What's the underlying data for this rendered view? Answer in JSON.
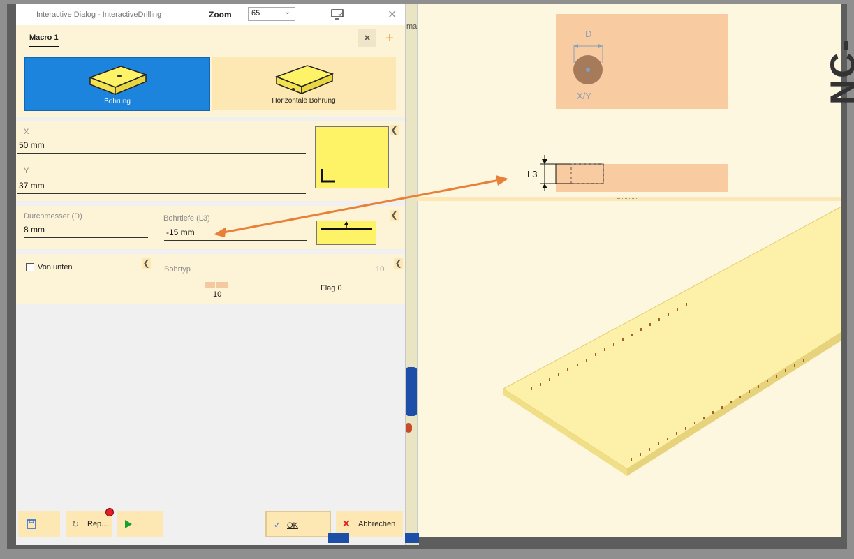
{
  "dialog": {
    "title": "Interactive Dialog - InteractiveDrilling",
    "zoom_label": "Zoom",
    "zoom_value": "65",
    "tab": "Macro 1",
    "tab_close": "×",
    "tab_add": "+"
  },
  "tiles": [
    {
      "label": "Bohrung",
      "selected": true
    },
    {
      "label": "Horizontale Bohrung",
      "selected": false
    }
  ],
  "position": {
    "x_label": "X",
    "x_value": "50 mm",
    "y_label": "Y",
    "y_value": "37 mm"
  },
  "drill": {
    "diameter_label": "Durchmesser (D)",
    "diameter_value": "8 mm",
    "depth_label": "Bohrtiefe (L3)",
    "depth_value": "-15 mm"
  },
  "options": {
    "from_below_label": "Von unten",
    "from_below_checked": false,
    "drill_type_label": "Bohrtyp",
    "drill_type_value": "10",
    "slider_value": "10",
    "flag_label": "Flag 0"
  },
  "footer": {
    "rep_label": "Rep...",
    "ok_label": "OK",
    "cancel_label": "Abbrechen"
  },
  "right_panel": {
    "brand": "NC-HOPS",
    "diagram_d": "D",
    "diagram_xy": "X/Y",
    "diagram_l3": "L3"
  },
  "background": {
    "partial_text": "ma"
  },
  "colors": {
    "accent_blue": "#1d84de",
    "panel_bg": "#fdf3d7",
    "yellow": "#fef266",
    "arrow": "#e9803a",
    "diagram_box": "#f9cba1"
  }
}
